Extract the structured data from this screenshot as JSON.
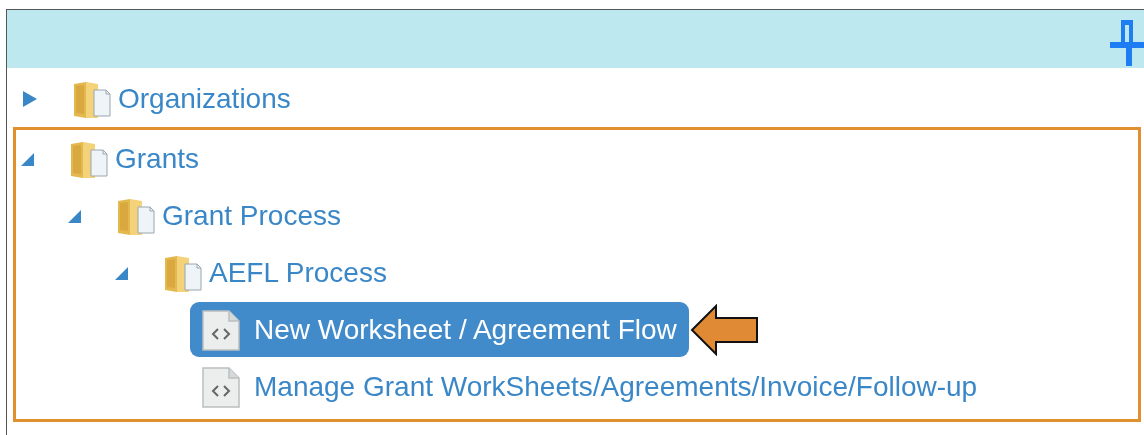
{
  "tree": [
    {
      "label": "Organizations",
      "kind": "folder",
      "expanded": false,
      "highlighted": false
    },
    {
      "label": "Grants",
      "kind": "folder",
      "expanded": true,
      "highlighted": true,
      "children": [
        {
          "label": "Grant Process",
          "kind": "folder",
          "expanded": true,
          "highlighted": false,
          "children": [
            {
              "label": "AEFL Process",
              "kind": "folder",
              "expanded": true,
              "highlighted": false,
              "children": [
                {
                  "label": "New Worksheet / Agreement Flow",
                  "kind": "page",
                  "selected": true,
                  "arrow": true
                },
                {
                  "label": "Manage Grant WorkSheets/Agreements/Invoice/Follow-up",
                  "kind": "page",
                  "selected": false,
                  "arrow": false
                }
              ]
            }
          ]
        }
      ]
    }
  ]
}
